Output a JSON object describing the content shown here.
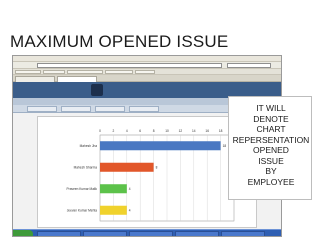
{
  "slide": {
    "title": "MAXIMUM OPENED ISSUE",
    "callout": "IT WILL\nDENOTE\nCHART\nREPERSENTATION\nOPENED\nISSUE\nBY\nEMPLOYEE"
  },
  "chart_data": {
    "type": "bar",
    "categories": [
      "Mahesh Jha",
      "Mahesh Sharma",
      "Praveen Kumar Malik",
      "Jeevan Kumar Mehta"
    ],
    "values": [
      18,
      8,
      4,
      4
    ],
    "xlim": [
      0,
      20
    ],
    "xticks": [
      0,
      2,
      4,
      6,
      8,
      10,
      12,
      14,
      16,
      18,
      20
    ],
    "colors": [
      "#4a78c2",
      "#e2572a",
      "#5cc24a",
      "#f0d22c"
    ],
    "grid": true
  }
}
